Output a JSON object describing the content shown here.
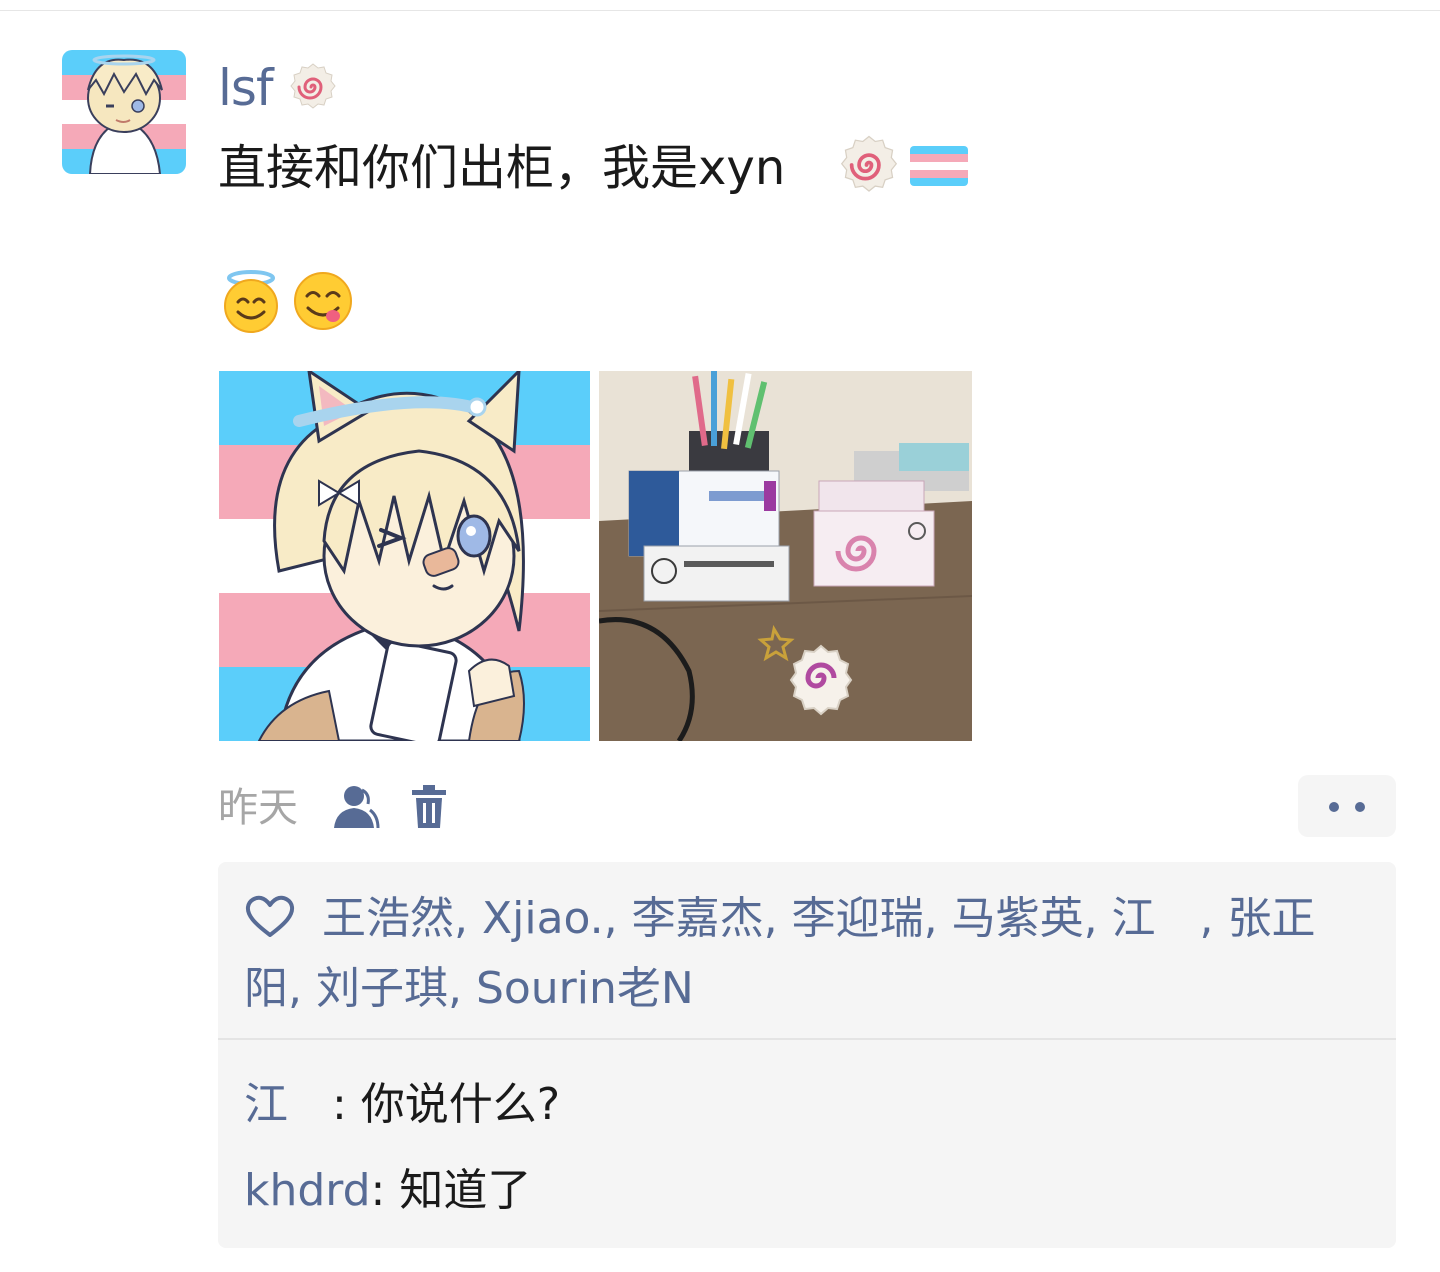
{
  "post": {
    "username": "lsf",
    "text": "直接和你们出柜，我是xyn",
    "image_count": 2
  },
  "meta": {
    "time": "昨天"
  },
  "likes": {
    "names_text": "王浩然, Xjiao., 李嘉杰, 李迎瑞, 马紫英, 江　, 张正阳, 刘子琪, Sourin老N"
  },
  "comments": [
    {
      "author": "江　",
      "separator": ": ",
      "text": "你说什么?"
    },
    {
      "author": "khdrd",
      "separator": ": ",
      "text": "知道了"
    }
  ],
  "icons": {
    "avatar": "trans-flag-catgirl-avatar",
    "badge": "fishcake-icon",
    "flag": "transgender-flag-icon",
    "emoji_1": "smiling-face-with-halo-emoji",
    "emoji_2": "face-savoring-food-emoji",
    "visibility": "people-icon",
    "delete": "trash-icon",
    "more": "more-dots-icon",
    "like": "heart-icon"
  },
  "colors": {
    "link_blue": "#576b95",
    "text": "#1a1a1a",
    "meta_grey": "#a6a6a6",
    "panel_bg": "#f5f5f5",
    "flag_blue": "#5bcefa",
    "flag_pink": "#f5a9b8"
  }
}
